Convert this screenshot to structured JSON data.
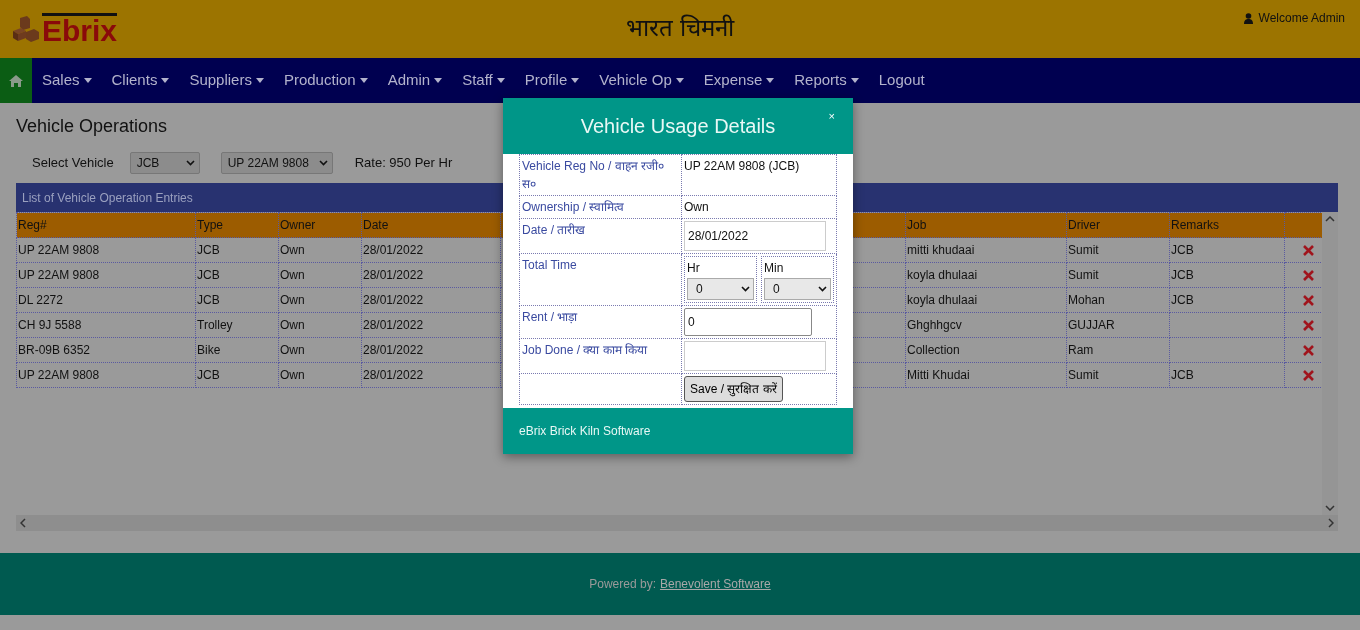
{
  "header": {
    "logo_text": "Ebrix",
    "title": "भारत चिमनी",
    "user": "Welcome Admin"
  },
  "nav": {
    "items": [
      {
        "label": "Sales",
        "dropdown": true
      },
      {
        "label": "Clients",
        "dropdown": true
      },
      {
        "label": "Suppliers",
        "dropdown": true
      },
      {
        "label": "Production",
        "dropdown": true
      },
      {
        "label": "Admin",
        "dropdown": true
      },
      {
        "label": "Staff",
        "dropdown": true
      },
      {
        "label": "Profile",
        "dropdown": true
      },
      {
        "label": "Vehicle Op",
        "dropdown": true
      },
      {
        "label": "Expense",
        "dropdown": true
      },
      {
        "label": "Reports",
        "dropdown": true
      },
      {
        "label": "Logout",
        "dropdown": false
      }
    ]
  },
  "page_title": "Vehicle Operations",
  "filters": {
    "label": "Select Vehicle",
    "type_select": "JCB",
    "vehicle_select": "UP 22AM 9808",
    "rate": "Rate: 950 Per Hr"
  },
  "table": {
    "title": "List of Vehicle Operation Entries",
    "columns": [
      "Reg#",
      "Type",
      "Owner",
      "Date",
      "Job",
      "Driver",
      "Remarks"
    ],
    "rows": [
      [
        "UP 22AM 9808",
        "JCB",
        "Own",
        "28/01/2022",
        "mitti khudaai",
        "Sumit",
        "JCB"
      ],
      [
        "UP 22AM 9808",
        "JCB",
        "Own",
        "28/01/2022",
        "koyla dhulaai",
        "Sumit",
        "JCB"
      ],
      [
        "DL 2272",
        "JCB",
        "Own",
        "28/01/2022",
        "koyla dhulaai",
        "Mohan",
        "JCB"
      ],
      [
        "CH 9J 5588",
        "Trolley",
        "Own",
        "28/01/2022",
        "Ghghhgcv",
        "GUJJAR",
        null
      ],
      [
        "BR-09B 6352",
        "Bike",
        "Own",
        "28/01/2022",
        "Collection",
        "Ram",
        null
      ],
      [
        "UP 22AM 9808",
        "JCB",
        "Own",
        "28/01/2022",
        "Mitti Khudai",
        "Sumit",
        "JCB"
      ]
    ]
  },
  "modal": {
    "title": "Vehicle Usage Details",
    "close": "×",
    "fields": [
      {
        "kind": "text",
        "label": "Vehicle Reg No / वाहन रजी० स०",
        "value": "UP 22AM 9808 (JCB)"
      },
      {
        "kind": "text",
        "label": "Ownership / स्वामित्व",
        "value": "Own"
      },
      {
        "kind": "input",
        "label": "Date / तारीख",
        "value": "28/01/2022"
      },
      {
        "kind": "time",
        "label": "Total Time",
        "hr_label": "Hr",
        "hr": "0",
        "min_label": "Min",
        "min": "0"
      },
      {
        "kind": "short-input",
        "label": "Rent / भाड़ा",
        "value": "0"
      },
      {
        "kind": "input",
        "label": "Job Done / क्या काम किया"
      },
      {
        "kind": "button",
        "value": "Save / सुरक्षित करें"
      }
    ],
    "footer": "eBrix Brick Kiln Software"
  },
  "footer": {
    "text": "Powered by:",
    "link": "Benevolent Software"
  }
}
